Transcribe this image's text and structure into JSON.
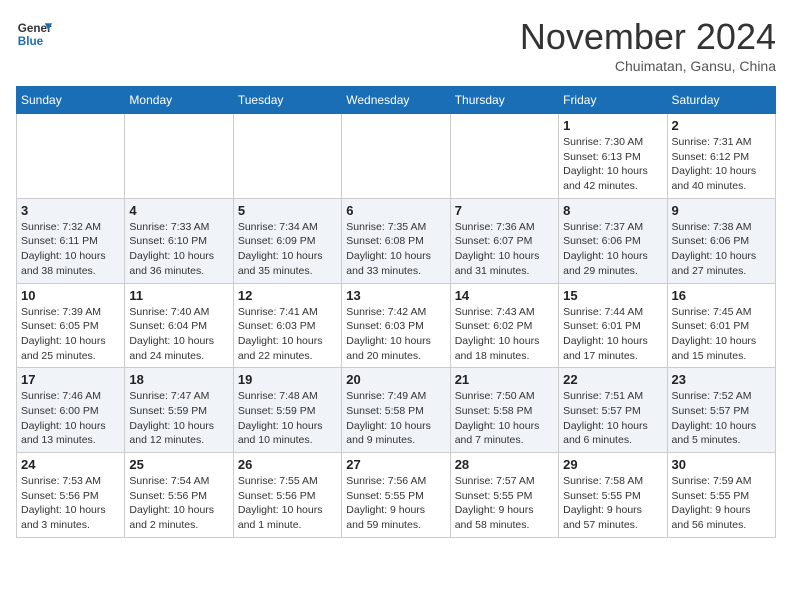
{
  "header": {
    "logo_line1": "General",
    "logo_line2": "Blue",
    "month": "November 2024",
    "location": "Chuimatan, Gansu, China"
  },
  "weekdays": [
    "Sunday",
    "Monday",
    "Tuesday",
    "Wednesday",
    "Thursday",
    "Friday",
    "Saturday"
  ],
  "weeks": [
    [
      {
        "day": "",
        "info": ""
      },
      {
        "day": "",
        "info": ""
      },
      {
        "day": "",
        "info": ""
      },
      {
        "day": "",
        "info": ""
      },
      {
        "day": "",
        "info": ""
      },
      {
        "day": "1",
        "info": "Sunrise: 7:30 AM\nSunset: 6:13 PM\nDaylight: 10 hours\nand 42 minutes."
      },
      {
        "day": "2",
        "info": "Sunrise: 7:31 AM\nSunset: 6:12 PM\nDaylight: 10 hours\nand 40 minutes."
      }
    ],
    [
      {
        "day": "3",
        "info": "Sunrise: 7:32 AM\nSunset: 6:11 PM\nDaylight: 10 hours\nand 38 minutes."
      },
      {
        "day": "4",
        "info": "Sunrise: 7:33 AM\nSunset: 6:10 PM\nDaylight: 10 hours\nand 36 minutes."
      },
      {
        "day": "5",
        "info": "Sunrise: 7:34 AM\nSunset: 6:09 PM\nDaylight: 10 hours\nand 35 minutes."
      },
      {
        "day": "6",
        "info": "Sunrise: 7:35 AM\nSunset: 6:08 PM\nDaylight: 10 hours\nand 33 minutes."
      },
      {
        "day": "7",
        "info": "Sunrise: 7:36 AM\nSunset: 6:07 PM\nDaylight: 10 hours\nand 31 minutes."
      },
      {
        "day": "8",
        "info": "Sunrise: 7:37 AM\nSunset: 6:06 PM\nDaylight: 10 hours\nand 29 minutes."
      },
      {
        "day": "9",
        "info": "Sunrise: 7:38 AM\nSunset: 6:06 PM\nDaylight: 10 hours\nand 27 minutes."
      }
    ],
    [
      {
        "day": "10",
        "info": "Sunrise: 7:39 AM\nSunset: 6:05 PM\nDaylight: 10 hours\nand 25 minutes."
      },
      {
        "day": "11",
        "info": "Sunrise: 7:40 AM\nSunset: 6:04 PM\nDaylight: 10 hours\nand 24 minutes."
      },
      {
        "day": "12",
        "info": "Sunrise: 7:41 AM\nSunset: 6:03 PM\nDaylight: 10 hours\nand 22 minutes."
      },
      {
        "day": "13",
        "info": "Sunrise: 7:42 AM\nSunset: 6:03 PM\nDaylight: 10 hours\nand 20 minutes."
      },
      {
        "day": "14",
        "info": "Sunrise: 7:43 AM\nSunset: 6:02 PM\nDaylight: 10 hours\nand 18 minutes."
      },
      {
        "day": "15",
        "info": "Sunrise: 7:44 AM\nSunset: 6:01 PM\nDaylight: 10 hours\nand 17 minutes."
      },
      {
        "day": "16",
        "info": "Sunrise: 7:45 AM\nSunset: 6:01 PM\nDaylight: 10 hours\nand 15 minutes."
      }
    ],
    [
      {
        "day": "17",
        "info": "Sunrise: 7:46 AM\nSunset: 6:00 PM\nDaylight: 10 hours\nand 13 minutes."
      },
      {
        "day": "18",
        "info": "Sunrise: 7:47 AM\nSunset: 5:59 PM\nDaylight: 10 hours\nand 12 minutes."
      },
      {
        "day": "19",
        "info": "Sunrise: 7:48 AM\nSunset: 5:59 PM\nDaylight: 10 hours\nand 10 minutes."
      },
      {
        "day": "20",
        "info": "Sunrise: 7:49 AM\nSunset: 5:58 PM\nDaylight: 10 hours\nand 9 minutes."
      },
      {
        "day": "21",
        "info": "Sunrise: 7:50 AM\nSunset: 5:58 PM\nDaylight: 10 hours\nand 7 minutes."
      },
      {
        "day": "22",
        "info": "Sunrise: 7:51 AM\nSunset: 5:57 PM\nDaylight: 10 hours\nand 6 minutes."
      },
      {
        "day": "23",
        "info": "Sunrise: 7:52 AM\nSunset: 5:57 PM\nDaylight: 10 hours\nand 5 minutes."
      }
    ],
    [
      {
        "day": "24",
        "info": "Sunrise: 7:53 AM\nSunset: 5:56 PM\nDaylight: 10 hours\nand 3 minutes."
      },
      {
        "day": "25",
        "info": "Sunrise: 7:54 AM\nSunset: 5:56 PM\nDaylight: 10 hours\nand 2 minutes."
      },
      {
        "day": "26",
        "info": "Sunrise: 7:55 AM\nSunset: 5:56 PM\nDaylight: 10 hours\nand 1 minute."
      },
      {
        "day": "27",
        "info": "Sunrise: 7:56 AM\nSunset: 5:55 PM\nDaylight: 9 hours\nand 59 minutes."
      },
      {
        "day": "28",
        "info": "Sunrise: 7:57 AM\nSunset: 5:55 PM\nDaylight: 9 hours\nand 58 minutes."
      },
      {
        "day": "29",
        "info": "Sunrise: 7:58 AM\nSunset: 5:55 PM\nDaylight: 9 hours\nand 57 minutes."
      },
      {
        "day": "30",
        "info": "Sunrise: 7:59 AM\nSunset: 5:55 PM\nDaylight: 9 hours\nand 56 minutes."
      }
    ]
  ]
}
